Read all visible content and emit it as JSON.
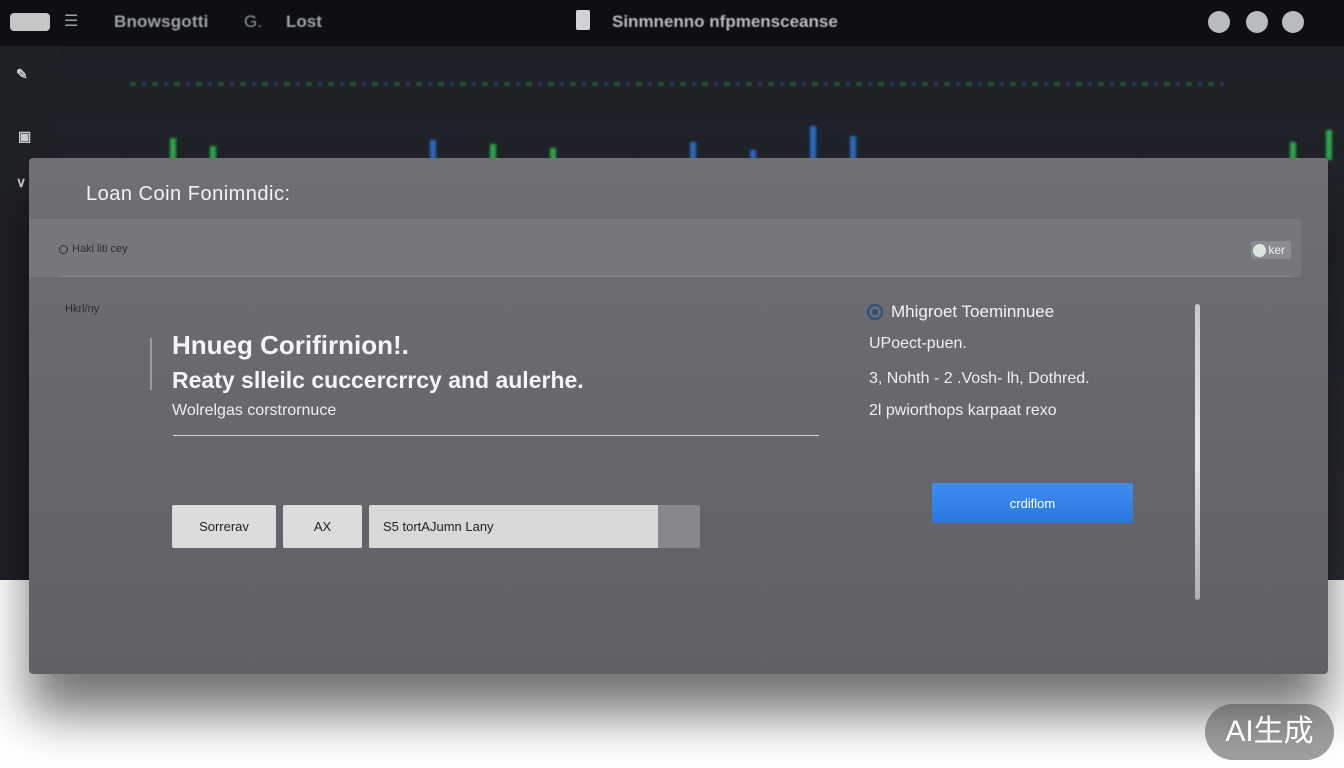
{
  "topbar": {
    "brand": "Bnowsgotti",
    "nav_g": "G.",
    "nav_lost": "Lost",
    "center_title": "Sinmnenno nfpmensceanse"
  },
  "modal": {
    "title": "Loan Coin Fonimndic:",
    "subheader_left": "Haki liti cey",
    "subheader_right": "ker",
    "left_caption": "Hkrl/ny",
    "heading_1": "Hnueg Corifirnion!.",
    "heading_2": "Reaty slleilc cuccercrrcy and aulerhe.",
    "subtext": "Wolrelgas corstrornuce",
    "buttons": {
      "secondary_1": "Sorrerav",
      "secondary_2": "AX"
    },
    "field_value": "S5 tortAJumn Lany",
    "right_panel": {
      "title": "Mhigroet Toeminnuee",
      "line_1": "UPoect-puen.",
      "line_2": "3, Nohth - 2 .Vosh- lh, Dothred.",
      "line_3": "2l pwiorthops karpaat rexo"
    },
    "confirm_label": "crdiflom"
  },
  "watermark": "AI生成",
  "colors": {
    "accent": "#2b78e0",
    "modal_bg": "#66686d",
    "topbar_bg": "#0d0f12"
  }
}
